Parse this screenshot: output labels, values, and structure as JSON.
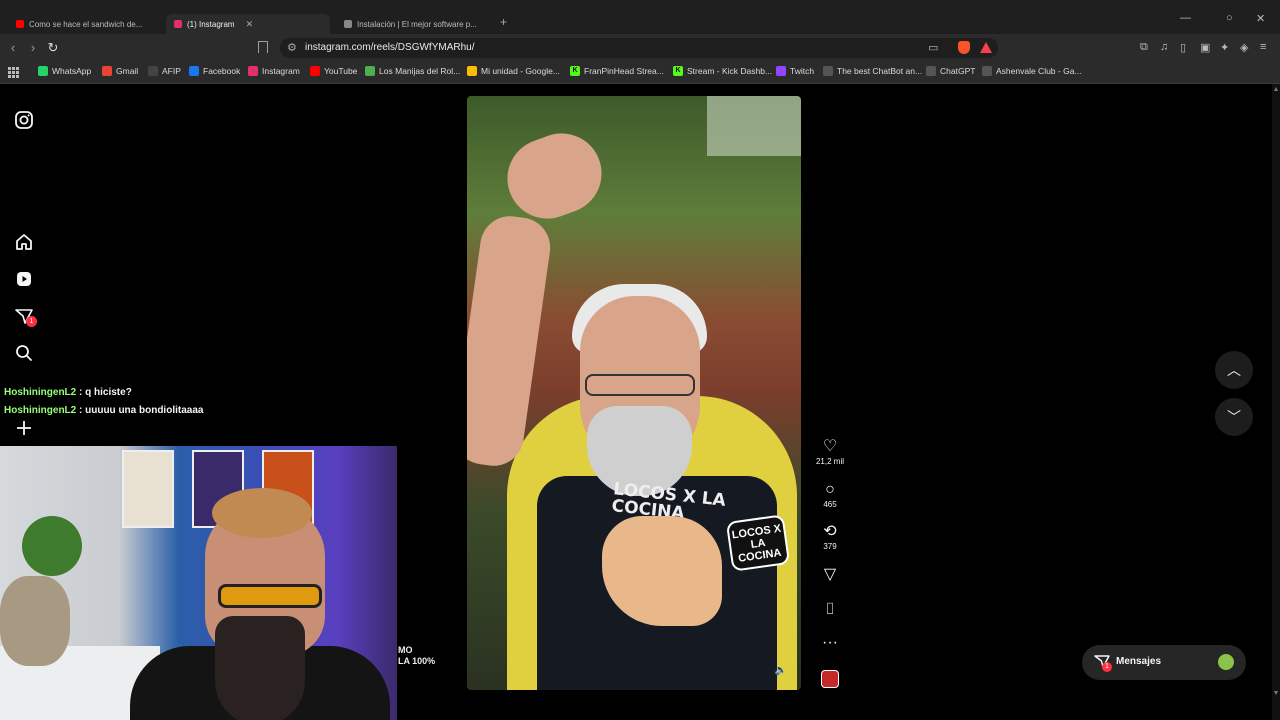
{
  "browser": {
    "tabs": [
      {
        "label": "Como se hace el sandwich de...",
        "active": false
      },
      {
        "label": "(1) Instagram",
        "active": true
      },
      {
        "label": "Instalación | El mejor software p...",
        "active": false
      }
    ],
    "address": "instagram.com/reels/DSGWfYMARhu/",
    "bookmarks": [
      {
        "label": "WhatsApp",
        "icon": "whatsapp-icon",
        "color": "#25d366"
      },
      {
        "label": "Gmail",
        "icon": "gmail-icon",
        "color": "#ea4335"
      },
      {
        "label": "AFIP",
        "icon": "afip-icon",
        "color": "#dddddd"
      },
      {
        "label": "Facebook",
        "icon": "facebook-icon",
        "color": "#1877f2"
      },
      {
        "label": "Instagram",
        "icon": "instagram-icon",
        "color": "#e1306c"
      },
      {
        "label": "YouTube",
        "icon": "youtube-icon",
        "color": "#ff0000"
      },
      {
        "label": "Los Manijas del Rol...",
        "icon": "bookmark-icon",
        "color": "#4caf50"
      },
      {
        "label": "Mi unidad - Google...",
        "icon": "drive-icon",
        "color": "#fbbc04"
      },
      {
        "label": "FranPinHead Strea...",
        "icon": "kick-icon",
        "color": "#53fc18"
      },
      {
        "label": "Stream - Kick Dashb...",
        "icon": "kick-icon",
        "color": "#53fc18"
      },
      {
        "label": "Twitch",
        "icon": "twitch-icon",
        "color": "#9146ff"
      },
      {
        "label": "The best ChatBot an...",
        "icon": "chatbot-icon",
        "color": "#dddddd"
      },
      {
        "label": "ChatGPT",
        "icon": "chatgpt-icon",
        "color": "#dddddd"
      },
      {
        "label": "Ashenvale Club - Ga...",
        "icon": "ashenvale-icon",
        "color": "#dddddd"
      }
    ]
  },
  "reel": {
    "likes": "21,2 mil",
    "comments": "465",
    "reposts": "379",
    "apron_text": "LOCOS X LA COCINA",
    "sticker_text": "LOCOS X LA COCINA"
  },
  "messages_button": {
    "label": "Mensajes",
    "badge": "1"
  },
  "notifications_badge": "1",
  "chat": [
    {
      "user": "HoshiningenL2",
      "message": ": q hiciste?"
    },
    {
      "user": "HoshiningenL2",
      "message": ": uuuuu una bondiolitaaaa"
    }
  ],
  "overlay": {
    "line1": "MO",
    "line2": "LA 100%"
  },
  "colors": {
    "accent_red": "#ff3040",
    "chat_user": "#9aff7a"
  }
}
